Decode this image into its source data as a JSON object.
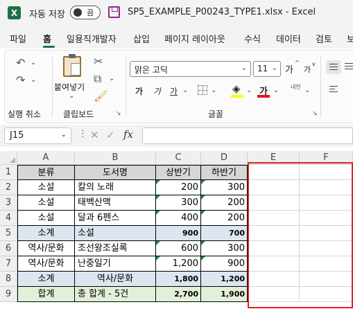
{
  "titlebar": {
    "app_logo": "X",
    "autosave_label": "자동 저장",
    "autosave_state": "끔",
    "document_title": "SP5_EXAMPLE_P00243_TYPE1.xlsx  -  Excel"
  },
  "menu": {
    "tabs": [
      "파일",
      "홈",
      "일용직개발자",
      "삽입",
      "페이지 레이아웃",
      "수식",
      "데이터",
      "검토",
      "보"
    ],
    "active_tab": "홈"
  },
  "ribbon": {
    "undo_group_label": "실행 취소",
    "clipboard": {
      "paste_label": "붙여넣기",
      "group_label": "클립보드"
    },
    "font": {
      "font_name": "맑은 고딕",
      "font_size": "11",
      "grow_label": "가",
      "shrink_label": "가",
      "bold_label": "가",
      "italic_label": "가",
      "underline_label": "가",
      "font_color_label": "가",
      "phonetic_label": "내천",
      "group_label": "글꼴",
      "highlight_color": "#ffff00",
      "font_color": "#e81123"
    }
  },
  "formula_bar": {
    "name_box": "J15",
    "fx_label": "fx",
    "formula": ""
  },
  "sheet": {
    "columns": [
      "A",
      "B",
      "C",
      "D",
      "E",
      "F"
    ],
    "rows": [
      "1",
      "2",
      "3",
      "4",
      "5",
      "6",
      "7",
      "8",
      "9"
    ],
    "cells": [
      [
        "분류",
        "도서명",
        "상반기",
        "하반기"
      ],
      [
        "소설",
        "칼의 노래",
        "200",
        "300"
      ],
      [
        "소설",
        "태백산맥",
        "300",
        "200"
      ],
      [
        "소설",
        "달과 6펜스",
        "400",
        "200"
      ],
      [
        "소계",
        "소설",
        "900",
        "700"
      ],
      [
        "역사/문화",
        "조선왕조실록",
        "600",
        "300"
      ],
      [
        "역사/문화",
        "난중일기",
        "1,200",
        "900"
      ],
      [
        "소계",
        "역사/문화",
        "1,800",
        "1,200"
      ],
      [
        "합계",
        "총 합계 - 5건",
        "2,700",
        "1,900"
      ]
    ],
    "colors": {
      "header_fill": "#d6d6d6",
      "subtotal_fill": "#dce6f1",
      "total_fill": "#e2f0d9",
      "highlight_border": "#d9231c",
      "error_marker": "#1e8c3c"
    }
  }
}
